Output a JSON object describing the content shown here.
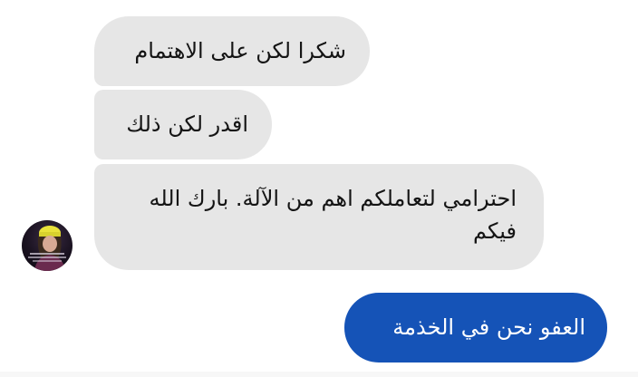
{
  "conversation": {
    "messages": [
      {
        "direction": "incoming",
        "text": "شكرا لكن على الاهتمام"
      },
      {
        "direction": "incoming",
        "text": "اقدر لكن ذلك"
      },
      {
        "direction": "incoming",
        "text": "احترامي لتعاملكم اهم من الآلة. بارك الله فيكم"
      },
      {
        "direction": "outgoing",
        "text": "العفو نحن في الخذمة"
      }
    ]
  },
  "colors": {
    "incoming_bubble": "#e6e6e6",
    "incoming_text": "#141414",
    "outgoing_bubble": "#1553b7",
    "outgoing_text": "#ffffff",
    "background": "#ffffff"
  },
  "icons": {
    "avatar": "profile-picture"
  }
}
